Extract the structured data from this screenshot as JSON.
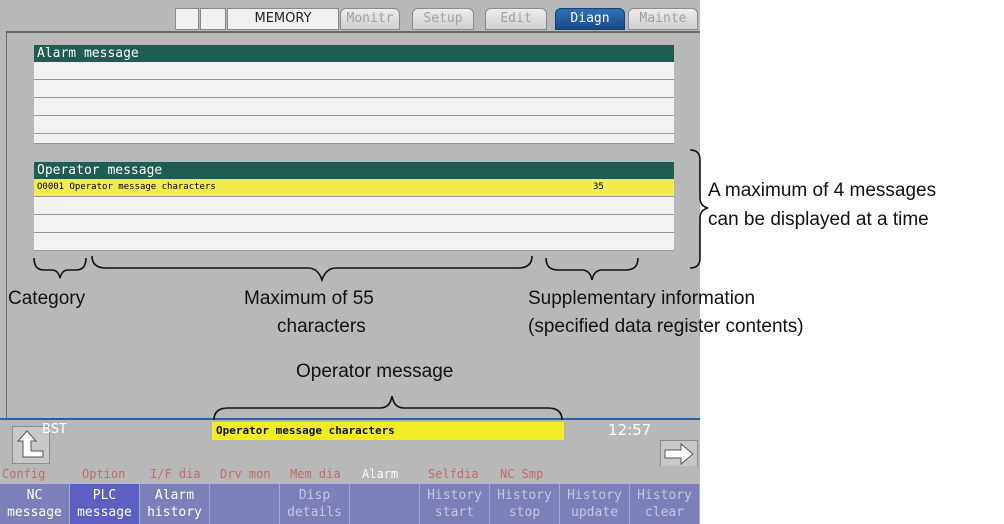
{
  "top_tabs": {
    "mode": "MEMORY",
    "tabs": [
      "Monitr",
      "Setup",
      "Edit",
      "Diagn",
      "Mainte"
    ],
    "active": "Diagn"
  },
  "alarm_panel": {
    "title": "Alarm message",
    "rows": [
      "",
      "",
      "",
      "",
      ""
    ]
  },
  "operator_panel": {
    "title": "Operator message",
    "rows": [
      {
        "message": "O0001 Operator message characters",
        "supplementary": "35"
      },
      {
        "message": "",
        "supplementary": ""
      },
      {
        "message": "",
        "supplementary": ""
      },
      {
        "message": "",
        "supplementary": ""
      }
    ]
  },
  "status": {
    "bst": "BST",
    "operator_message": "Operator message characters",
    "time": "12:57"
  },
  "menu_row": [
    "Config",
    "Option",
    "I/F dia",
    "Drv mon",
    "Mem dia",
    "Alarm",
    "Selfdia",
    "NC Smp"
  ],
  "menu_active": "Alarm",
  "softkeys": [
    {
      "line1": "NC",
      "line2": "message"
    },
    {
      "line1": "PLC",
      "line2": "message"
    },
    {
      "line1": "Alarm",
      "line2": "history"
    },
    {
      "line1": "",
      "line2": ""
    },
    {
      "line1": "Disp",
      "line2": "details"
    },
    {
      "line1": "",
      "line2": ""
    },
    {
      "line1": "History",
      "line2": "start"
    },
    {
      "line1": "History",
      "line2": "stop"
    },
    {
      "line1": "History",
      "line2": "update"
    },
    {
      "line1": "History",
      "line2": "clear"
    }
  ],
  "annotations": {
    "max_messages_line1": "A maximum of 4 messages",
    "max_messages_line2": "can be displayed at a time",
    "category": "Category",
    "max_chars_line1": "Maximum of 55",
    "max_chars_line2": "characters",
    "supp_line1": "Supplementary information",
    "supp_line2": "(specified data register contents)",
    "operator_message": "Operator message"
  }
}
